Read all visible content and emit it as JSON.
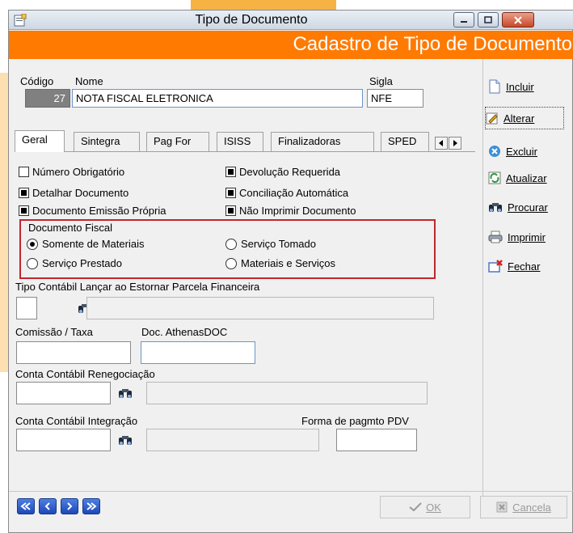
{
  "window": {
    "title": "Tipo de Documento"
  },
  "header": {
    "title": "Cadastro de Tipo de Documento"
  },
  "fields": {
    "codigo_label": "Código",
    "codigo_value": "27",
    "nome_label": "Nome",
    "nome_value": "NOTA FISCAL ELETRONICA",
    "sigla_label": "Sigla",
    "sigla_value": "NFE"
  },
  "tabs": [
    "Geral",
    "Sintegra",
    "Pag For",
    "ISISS",
    "Finalizadoras",
    "SPED"
  ],
  "checkboxes": [
    {
      "label": "Número Obrigatório",
      "checked": false
    },
    {
      "label": "Devolução Requerida",
      "checked": true
    },
    {
      "label": "Detalhar Documento",
      "checked": true
    },
    {
      "label": "Conciliação Automática",
      "checked": true
    },
    {
      "label": "Documento Emissão Própria",
      "checked": true
    },
    {
      "label": "Não Imprimir Documento",
      "checked": true
    }
  ],
  "documento_fiscal": {
    "label": "Documento Fiscal",
    "options": [
      {
        "label": "Somente de Materiais",
        "selected": true
      },
      {
        "label": "Serviço Tomado",
        "selected": false
      },
      {
        "label": "Serviço Prestado",
        "selected": false
      },
      {
        "label": "Materiais e Serviços",
        "selected": false
      }
    ]
  },
  "labels": {
    "tipo_contabil": "Tipo Contábil Lançar ao Estornar Parcela Financeira",
    "comissao": "Comissão / Taxa",
    "doc_athenas": "Doc. AthenasDOC",
    "conta_renegociacao": "Conta Contábil Renegociação",
    "conta_integracao": "Conta Contábil Integração",
    "forma_pagmto": "Forma de pagmto PDV"
  },
  "side_buttons": [
    {
      "label": "Incluir",
      "icon": "document-icon"
    },
    {
      "label": "Alterar",
      "icon": "edit-icon"
    },
    {
      "label": "Excluir",
      "icon": "delete-icon"
    },
    {
      "label": "Atualizar",
      "icon": "refresh-icon"
    },
    {
      "label": "Procurar",
      "icon": "binoculars-icon"
    },
    {
      "label": "Imprimir",
      "icon": "printer-icon"
    },
    {
      "label": "Fechar",
      "icon": "close-window-icon"
    }
  ],
  "footer": {
    "ok_label": "OK",
    "cancel_label": "Cancela"
  },
  "colors": {
    "header": "#ff7a00",
    "highlight": "#c0262e",
    "nav": "#1d47b8"
  }
}
